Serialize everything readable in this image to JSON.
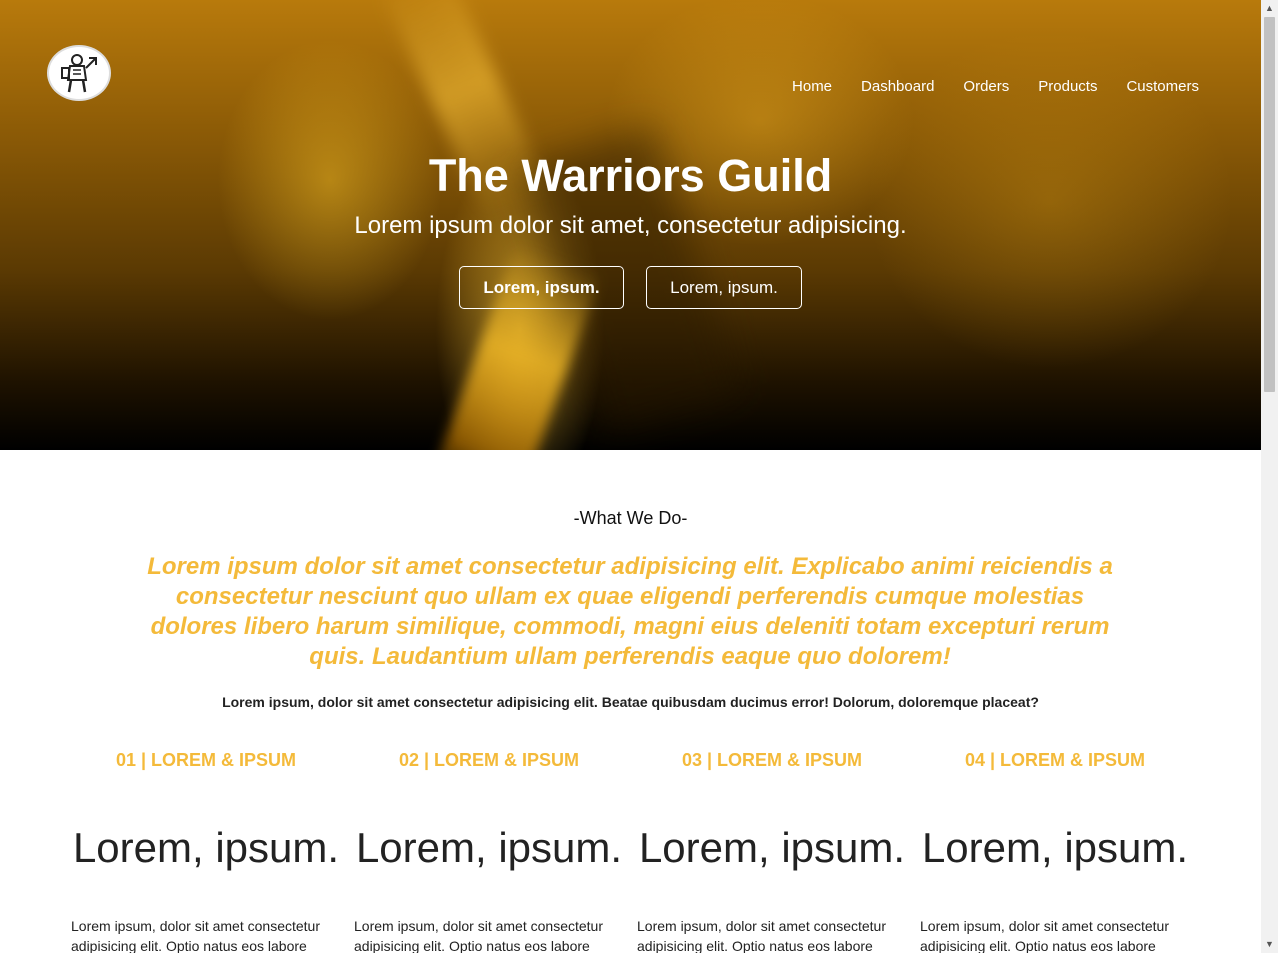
{
  "header": {
    "logo_icon": "knight-logo-icon",
    "nav": [
      {
        "label": "Home"
      },
      {
        "label": "Dashboard"
      },
      {
        "label": "Orders"
      },
      {
        "label": "Products"
      },
      {
        "label": "Customers"
      }
    ]
  },
  "hero": {
    "title": "The Warriors Guild",
    "subtitle": "Lorem ipsum dolor sit amet, consectetur adipisicing.",
    "primary_button": "Lorem, ipsum.",
    "secondary_button": "Lorem, ipsum."
  },
  "about": {
    "label": "-What We Do-",
    "lead": "Lorem ipsum dolor sit amet consectetur adipisicing elit. Explicabo animi reiciendis a consectetur nesciunt quo ullam ex quae eligendi perferendis cumque molestias dolores libero harum similique, commodi, magni eius deleniti totam excepturi rerum quis. Laudantium ullam perferendis eaque quo dolorem!",
    "subtext": "Lorem ipsum, dolor sit amet consectetur adipisicing elit. Beatae quibusdam ducimus error! Dolorum, doloremque placeat?"
  },
  "columns": [
    {
      "heading": "01 | LOREM & IPSUM",
      "big": "Lorem, ipsum.",
      "text": "Lorem ipsum, dolor sit amet consectetur adipisicing elit. Optio natus eos labore"
    },
    {
      "heading": "02 | LOREM & IPSUM",
      "big": "Lorem, ipsum.",
      "text": "Lorem ipsum, dolor sit amet consectetur adipisicing elit. Optio natus eos labore"
    },
    {
      "heading": "03 | LOREM & IPSUM",
      "big": "Lorem, ipsum.",
      "text": "Lorem ipsum, dolor sit amet consectetur adipisicing elit. Optio natus eos labore"
    },
    {
      "heading": "04 | LOREM & IPSUM",
      "big": "Lorem, ipsum.",
      "text": "Lorem ipsum, dolor sit amet consectetur adipisicing elit. Optio natus eos labore"
    }
  ],
  "colors": {
    "accent": "#f4ba3a",
    "hero_dark": "#000000",
    "hero_gold": "#b87a0c"
  }
}
